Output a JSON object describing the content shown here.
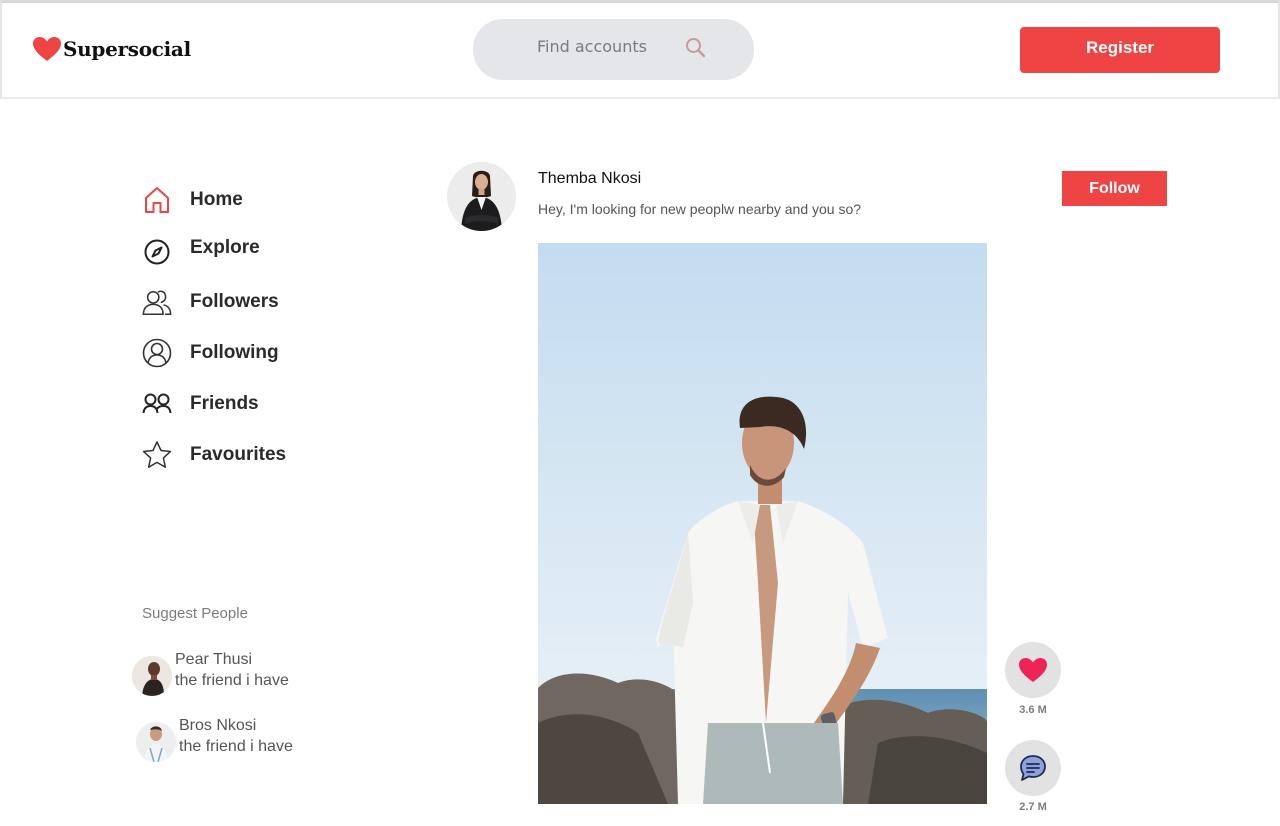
{
  "brand": {
    "name": "Supersocial",
    "heart_color": "#ef4444"
  },
  "search": {
    "placeholder": "Find accounts"
  },
  "header": {
    "register_label": "Register"
  },
  "sidebar": {
    "items": [
      {
        "label": "Home",
        "icon": "home-icon",
        "active": true
      },
      {
        "label": "Explore",
        "icon": "compass-icon"
      },
      {
        "label": "Followers",
        "icon": "users-icon"
      },
      {
        "label": "Following",
        "icon": "user-circle-icon"
      },
      {
        "label": "Friends",
        "icon": "friends-icon"
      },
      {
        "label": "Favourites",
        "icon": "star-icon"
      }
    ]
  },
  "suggest": {
    "title": "Suggest People",
    "people": [
      {
        "name": "Pear Thusi",
        "subtitle": "the friend i have"
      },
      {
        "name": "Bros Nkosi",
        "subtitle": "the friend i have"
      }
    ]
  },
  "post": {
    "author": "Themba Nkosi",
    "caption": "Hey, I'm looking for new peoplw nearby and you so?",
    "follow_label": "Follow",
    "likes": "3.6 M",
    "comments": "2.7 M"
  },
  "colors": {
    "accent": "#ef4444",
    "search_bg": "#e5e6ea",
    "action_bg": "#e2e2e2",
    "like_heart": "#ee2456"
  }
}
